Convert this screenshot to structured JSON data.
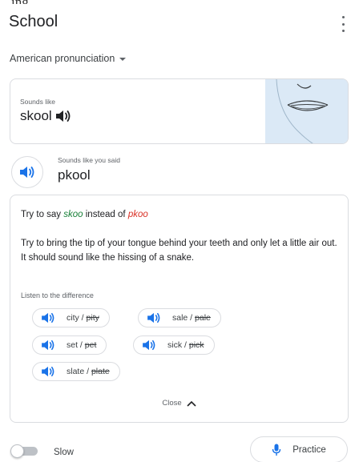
{
  "top_cut_text": "ing",
  "header": {
    "title": "School",
    "menu_icon": "more-vert-icon"
  },
  "accent": {
    "label": "American pronunciation",
    "icon": "arrow-drop-down-icon"
  },
  "sounds_like_card": {
    "label": "Sounds like",
    "word": "skool",
    "speaker_icon": "volume-icon",
    "illustration": "mouth-illustration"
  },
  "you_said": {
    "label": "Sounds like you said",
    "word": "pkool",
    "speaker_icon": "volume-icon"
  },
  "tip": {
    "prefix": "Try to say ",
    "target": "skoo",
    "middle": " instead of ",
    "said": "pkoo",
    "body": "Try to bring the tip of your tongue behind your teeth and only let a little air out. It should sound like the hissing of a snake.",
    "listen_label": "Listen to the difference",
    "pairs": [
      {
        "good": "city",
        "sep": " / ",
        "bad": "pity"
      },
      {
        "good": "sale",
        "sep": " / ",
        "bad": "pale"
      },
      {
        "good": "set",
        "sep": " / ",
        "bad": "pet"
      },
      {
        "good": "sick",
        "sep": " / ",
        "bad": "pick"
      },
      {
        "good": "slate",
        "sep": " / ",
        "bad": "plate"
      }
    ],
    "close_label": "Close",
    "close_icon": "chevron-up-icon"
  },
  "footer": {
    "slow_label": "Slow",
    "slow_enabled": false,
    "practice_label": "Practice",
    "practice_icon": "mic-icon"
  },
  "colors": {
    "accent_blue": "#1a73e8",
    "good_green": "#188038",
    "bad_red": "#d93025",
    "border": "#dadce0",
    "mouth_bg": "#dbe9f6"
  }
}
